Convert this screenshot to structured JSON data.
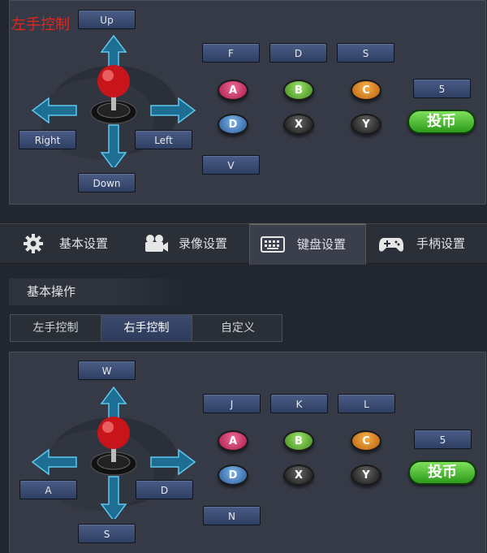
{
  "overlay_title": "左手控制",
  "top_panel": {
    "direction_keys": {
      "up": "Up",
      "right": "Right",
      "left": "Left",
      "down": "Down"
    },
    "function_keys": {
      "top1": "F",
      "top2": "D",
      "top3": "S",
      "bottom": "V",
      "coin_key": "5"
    },
    "buttons": {
      "a": "A",
      "b": "B",
      "c": "C",
      "d": "D",
      "x": "X",
      "y": "Y",
      "coin": "投币"
    }
  },
  "tabs": [
    {
      "label": "基本设置",
      "icon": "gear-icon"
    },
    {
      "label": "录像设置",
      "icon": "camera-icon"
    },
    {
      "label": "键盘设置",
      "icon": "keyboard-icon",
      "active": true
    },
    {
      "label": "手柄设置",
      "icon": "gamepad-icon"
    }
  ],
  "section_title": "基本操作",
  "subtabs": [
    {
      "label": "左手控制"
    },
    {
      "label": "右手控制",
      "active": true
    },
    {
      "label": "自定义"
    }
  ],
  "bottom_panel": {
    "direction_keys": {
      "up": "W",
      "right": "A",
      "left": "D",
      "down": "S"
    },
    "function_keys": {
      "top1": "J",
      "top2": "K",
      "top3": "L",
      "bottom": "N",
      "coin_key": "5"
    },
    "buttons": {
      "a": "A",
      "b": "B",
      "c": "C",
      "d": "D",
      "x": "X",
      "y": "Y",
      "coin": "投币"
    }
  },
  "colors": {
    "accent": "#3d4b6e",
    "title_red": "#e8231c",
    "coin_green": "#2c9a1c"
  }
}
